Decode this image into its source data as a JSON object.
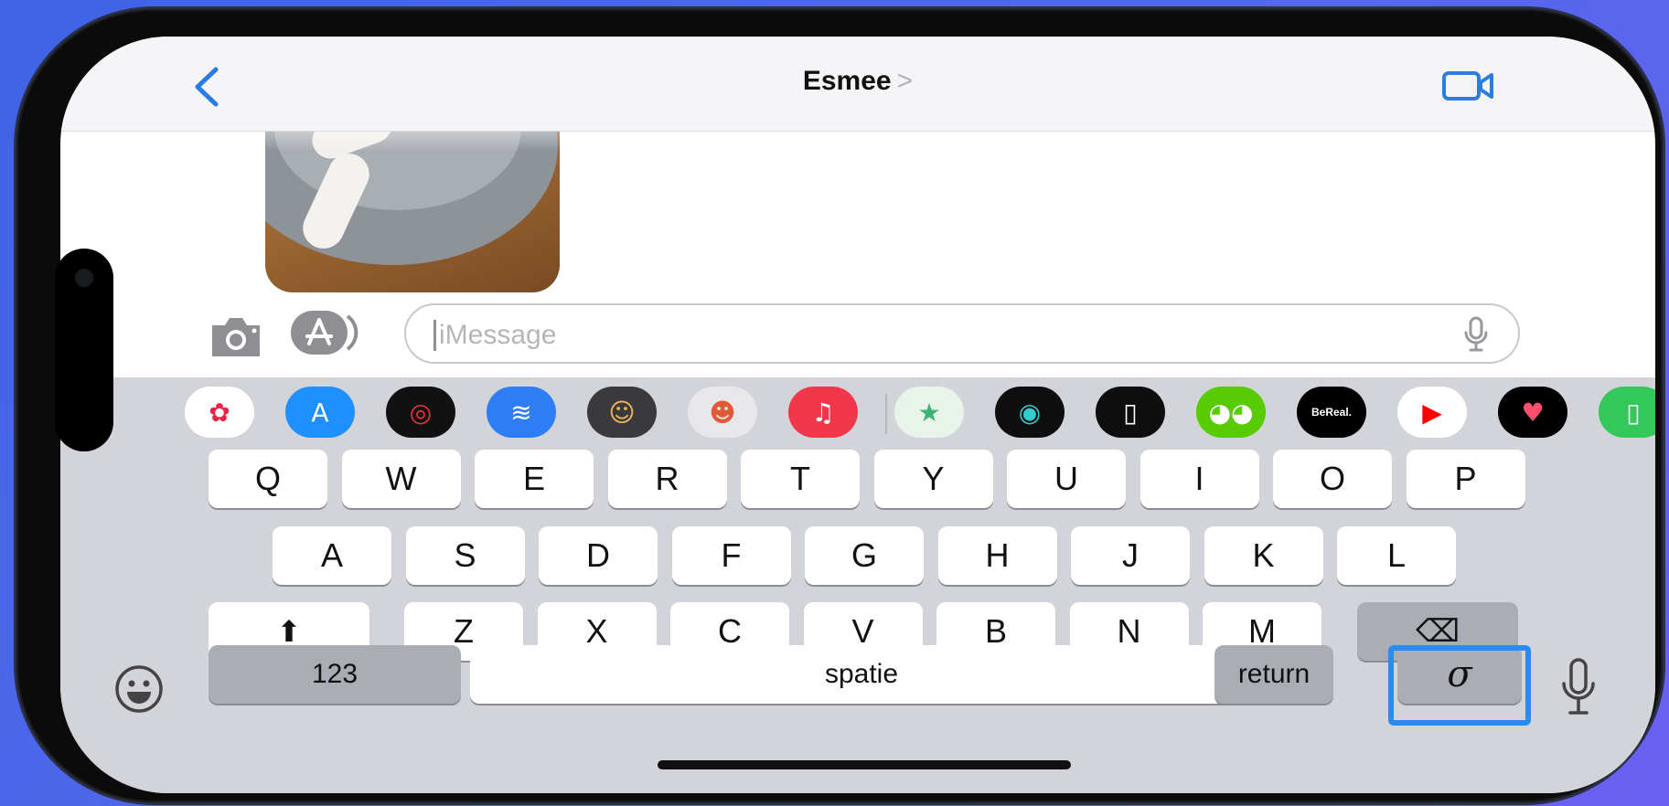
{
  "navbar": {
    "contact_name": "Esmee",
    "chevron": ">"
  },
  "input": {
    "placeholder": "iMessage"
  },
  "app_strip": [
    {
      "name": "photos-app-icon",
      "bg": "#ffffff",
      "glyph": "✿",
      "color": "#e24"
    },
    {
      "name": "app-store-app-icon",
      "bg": "#1e90ff",
      "glyph": "A",
      "color": "#fff"
    },
    {
      "name": "activity-app-icon",
      "bg": "#111111",
      "glyph": "◎",
      "color": "#e33"
    },
    {
      "name": "audio-messages-app-icon",
      "bg": "#2f7df6",
      "glyph": "≋",
      "color": "#fff"
    },
    {
      "name": "memoji-app-icon",
      "bg": "#3a3a3c",
      "glyph": "☺",
      "color": "#f1b35b"
    },
    {
      "name": "memoji-stickers-app-icon",
      "bg": "#e8e8ea",
      "glyph": "☻",
      "color": "#e05a3a"
    },
    {
      "name": "music-app-icon",
      "bg": "#f0384a",
      "glyph": "♫",
      "color": "#fff"
    },
    {
      "name": "sticker-app-icon",
      "bg": "#e8f4ea",
      "glyph": "★",
      "color": "#3cb371"
    },
    {
      "name": "find-my-app-icon",
      "bg": "#0e0e0e",
      "glyph": "◉",
      "color": "#3cc"
    },
    {
      "name": "notes-app-icon",
      "bg": "#0e0e0e",
      "glyph": "▯",
      "color": "#fff"
    },
    {
      "name": "duolingo-app-icon",
      "bg": "#58cc02",
      "glyph": "◕◕",
      "color": "#fff"
    },
    {
      "name": "bereal-app-icon",
      "bg": "#000000",
      "glyph": "BeReal.",
      "color": "#fff"
    },
    {
      "name": "youtube-app-icon",
      "bg": "#ffffff",
      "glyph": "▶",
      "color": "#ff0000"
    },
    {
      "name": "heart-app-icon",
      "bg": "#000000",
      "glyph": "♥",
      "color": "#ff4f6d"
    },
    {
      "name": "partial-app-icon",
      "bg": "#34c759",
      "glyph": "▯",
      "color": "#fff"
    }
  ],
  "keys": {
    "row1": [
      "Q",
      "W",
      "E",
      "R",
      "T",
      "Y",
      "U",
      "I",
      "O",
      "P"
    ],
    "row2": [
      "A",
      "S",
      "D",
      "F",
      "G",
      "H",
      "J",
      "K",
      "L"
    ],
    "row3": [
      "Z",
      "X",
      "C",
      "V",
      "B",
      "N",
      "M"
    ],
    "numbers": "123",
    "space": "spatie",
    "return": "return",
    "shift_glyph": "⬆",
    "delete_glyph": "⌫",
    "handwriting_glyph": "σ"
  },
  "colors": {
    "accent": "#2a7de1",
    "highlight": "#2a8cf0",
    "keyboard_bg": "#d3d4d9"
  }
}
